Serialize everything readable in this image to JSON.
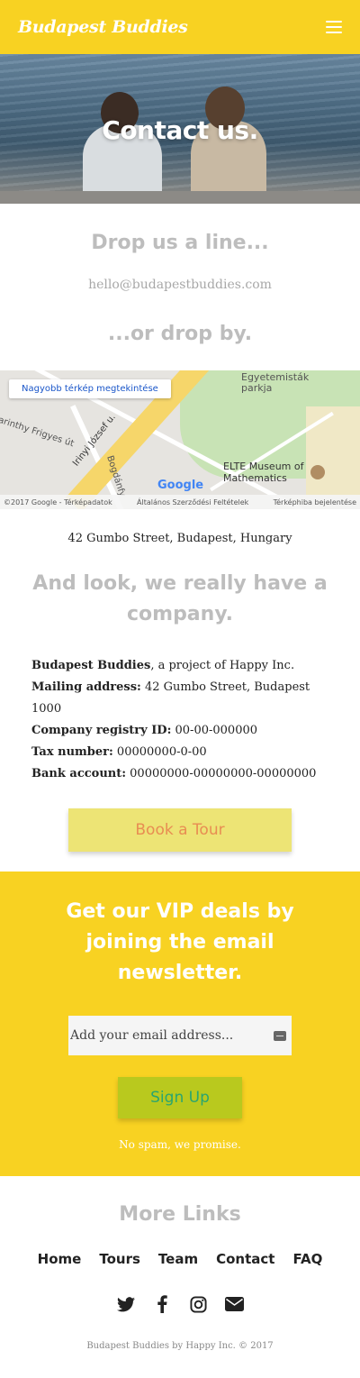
{
  "header": {
    "brand": "Budapest Buddies",
    "menu_icon": "hamburger-icon"
  },
  "hero": {
    "title": "Contact us."
  },
  "contact": {
    "drop_line_title": "Drop us a line...",
    "email": "hello@budapestbuddies.com",
    "drop_by_title": "...or drop by."
  },
  "map": {
    "bigger_map_link": "Nagyobb térkép megtekintése",
    "label_park": "Egyetemisták parkja",
    "label_street1": "Irinyi József u.",
    "label_street2": "Bogdánfy",
    "label_street3": "Karinthy Frigyes út",
    "label_museum": "ELTE Museum of Mathematics",
    "google": "Google",
    "footer_left": "©2017 Google - Térképadatok",
    "footer_mid": "Általános Szerződési Feltételek",
    "footer_right": "Térképhiba bejelentése"
  },
  "address": "42 Gumbo Street, Budapest, Hungary",
  "company": {
    "title": "And look, we really have a company.",
    "name_label": "Budapest Buddies",
    "name_value": ", a project of Happy Inc.",
    "mailing_label": "Mailing address:",
    "mailing_value": " 42 Gumbo Street, Budapest 1000",
    "registry_label": "Company registry ID:",
    "registry_value": " 00-00-000000",
    "tax_label": "Tax number:",
    "tax_value": " 00000000-0-00",
    "bank_label": "Bank account:",
    "bank_value": " 00000000-00000000-00000000"
  },
  "cta": {
    "book": "Book a Tour"
  },
  "newsletter": {
    "title": "Get our VIP deals by joining the email newsletter.",
    "placeholder": "Add your email address...",
    "signup": "Sign Up",
    "note": "No spam, we promise."
  },
  "footer": {
    "more_title": "More Links",
    "links": [
      "Home",
      "Tours",
      "Team",
      "Contact",
      "FAQ"
    ],
    "social": [
      "twitter-icon",
      "facebook-icon",
      "instagram-icon",
      "envelope-icon"
    ],
    "copyright": "Budapest Buddies by Happy Inc. © 2017"
  },
  "colors": {
    "brand_yellow": "#f8d222",
    "book_button": "#ede475",
    "signup_button": "#b9c91e",
    "title_gray": "#bdbdbd"
  }
}
